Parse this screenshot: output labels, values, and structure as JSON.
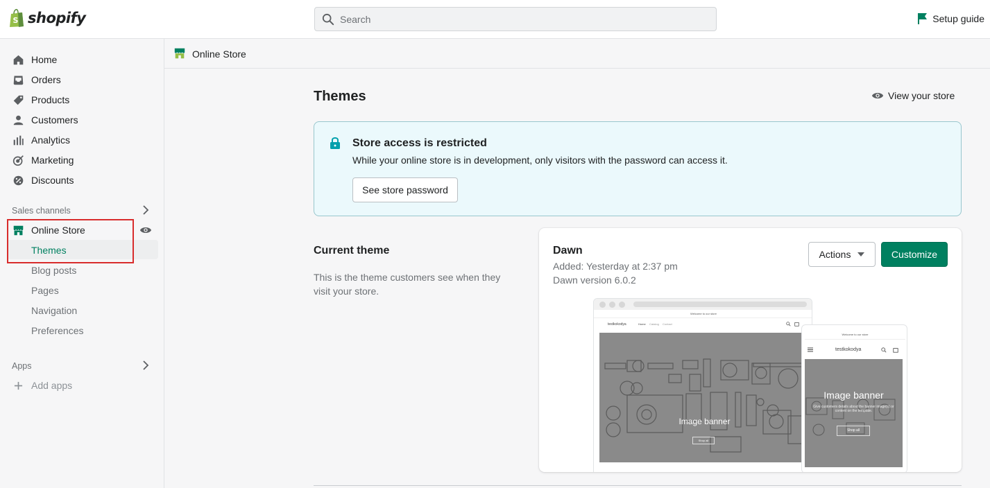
{
  "brand": {
    "name": "shopify",
    "color": "#95bf47"
  },
  "search": {
    "placeholder": "Search"
  },
  "setup_guide": {
    "label": "Setup guide"
  },
  "sidebar": {
    "items": [
      {
        "label": "Home",
        "icon": "home-icon"
      },
      {
        "label": "Orders",
        "icon": "orders-icon"
      },
      {
        "label": "Products",
        "icon": "tag-icon"
      },
      {
        "label": "Customers",
        "icon": "person-icon"
      },
      {
        "label": "Analytics",
        "icon": "bar-chart-icon"
      },
      {
        "label": "Marketing",
        "icon": "target-icon"
      },
      {
        "label": "Discounts",
        "icon": "discount-icon"
      }
    ],
    "sales_channels_label": "Sales channels",
    "online_store": {
      "label": "Online Store",
      "sub_items": [
        "Themes",
        "Blog posts",
        "Pages",
        "Navigation",
        "Preferences"
      ],
      "active_sub": "Themes"
    },
    "apps_label": "Apps",
    "add_apps_label": "Add apps"
  },
  "subheader": {
    "title": "Online Store"
  },
  "page": {
    "title": "Themes",
    "view_store_label": "View your store"
  },
  "banner": {
    "title": "Store access is restricted",
    "text": "While your online store is in development, only visitors with the password can access it.",
    "button_label": "See store password"
  },
  "current_theme": {
    "heading": "Current theme",
    "description": "This is the theme customers see when they visit your store.",
    "name": "Dawn",
    "added": "Added: Yesterday at 2:37 pm",
    "version": "Dawn version 6.0.2",
    "actions_label": "Actions",
    "customize_label": "Customize"
  },
  "preview": {
    "announcement": "Welcome to our store",
    "store_name": "testkokodya",
    "nav_links": [
      "Home",
      "Catalog",
      "Contact"
    ],
    "banner_title": "Image banner",
    "banner_sub": "Give customers details about the banner image(s) or content on the template.",
    "shop_all": "Shop all"
  },
  "colors": {
    "accent": "#008060",
    "banner_bg": "#ebf9fc",
    "highlight": "#d82c2c"
  }
}
